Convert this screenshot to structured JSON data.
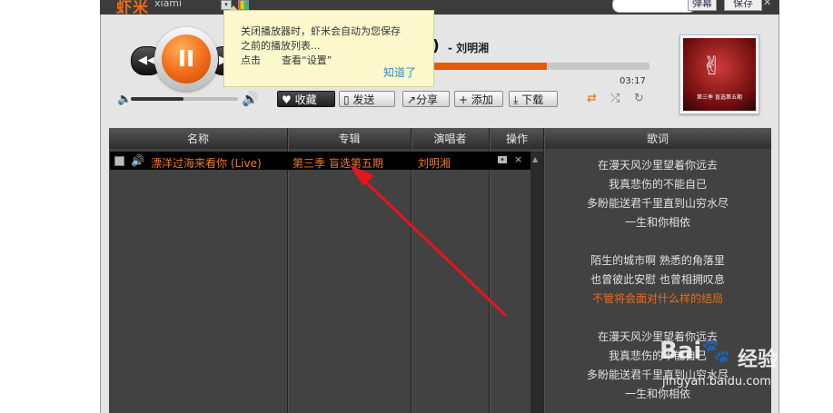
{
  "app": {
    "logo_cn": "虾米",
    "logo_en": "xiami",
    "tb_btn1": "弹幕",
    "tb_btn2": "保存",
    "close_glyph": "✕"
  },
  "player": {
    "song_title_tail": ")",
    "artist": "- 刘明湘",
    "time": "03:17",
    "progress_percent": 54,
    "volume_percent": 49,
    "prev_glyph": "◀◀",
    "pause_glyph": "II",
    "next_glyph": "▶"
  },
  "actions": {
    "favorite": "收藏",
    "send": "发送",
    "share": "分享",
    "add": "添加",
    "download": "下载"
  },
  "icons": {
    "favorite": "heart-icon",
    "send": "phone-icon",
    "share": "share-icon",
    "add": "plus-icon",
    "download": "download-icon",
    "repeat": "repeat-icon",
    "shuffle": "shuffle-icon",
    "single": "single-loop-icon"
  },
  "tooltip": {
    "line1": "关闭播放器时，虾米会自动为您保存",
    "line2": "之前的播放列表...",
    "click": "点击",
    "view": "查看“设置”",
    "ok": "知道了"
  },
  "album": {
    "art_text": "第三季 盲选第五期"
  },
  "table": {
    "headers": [
      "名称",
      "专辑",
      "演唱者",
      "操作",
      "歌词"
    ],
    "rows": [
      {
        "name": "漂洋过海来看你 (Live)",
        "album": "第三季 盲选第五期",
        "artist": "刘明湘"
      }
    ]
  },
  "lyrics": {
    "lines": [
      "在漫天风沙里望着你远去",
      "我真悲伤的不能自已",
      "多盼能送君千里直到山穷水尽",
      "一生和你相依",
      "",
      "陌生的城市啊 熟悉的角落里",
      "也曾彼此安慰 也曾相拥叹息",
      "不管将会面对什么样的结局",
      "",
      "在漫天风沙里望着你远去",
      "我真悲伤的不能自已",
      "多盼能送君千里直到山穷水尽",
      "一生和你相依"
    ],
    "current_index": 7
  },
  "colors": {
    "accent": "#f06a16",
    "link": "#2c86c9",
    "annotation": "#e8141b"
  },
  "watermark": {
    "brand": "Bai",
    "brand_text": "经验",
    "url": "jingyan.baidu.com"
  }
}
